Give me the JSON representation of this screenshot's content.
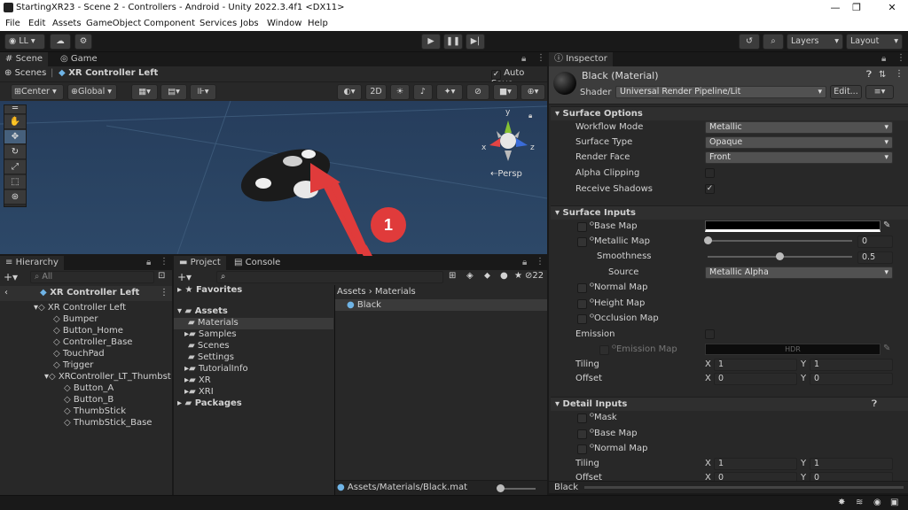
{
  "window": {
    "title": "StartingXR23 - Scene 2 - Controllers - Android - Unity 2022.3.4f1 <DX11>",
    "controls": [
      "—",
      "❐",
      "✕"
    ]
  },
  "menu": [
    "File",
    "Edit",
    "Assets",
    "GameObject",
    "Component",
    "Services",
    "Jobs",
    "Window",
    "Help"
  ],
  "toolbar": {
    "account": "LL",
    "layers": "Layers",
    "layout": "Layout"
  },
  "scene_tabs": {
    "scene": "Scene",
    "game": "Game"
  },
  "breadcrumb": {
    "scenes": "Scenes",
    "object": "XR Controller Left",
    "auto_save": "Auto Save"
  },
  "scene_toolbar": {
    "pivot": "Center",
    "space": "Global",
    "mode_2d": "2D"
  },
  "gizmo": {
    "x": "x",
    "y": "y",
    "z": "z",
    "persp": "Persp"
  },
  "annotation": {
    "number": "1"
  },
  "hierarchy": {
    "tab": "Hierarchy",
    "search_placeholder": "All",
    "root": "XR Controller Left",
    "items": [
      {
        "label": "XR Controller Left",
        "depth": 1
      },
      {
        "label": "Bumper",
        "depth": 2
      },
      {
        "label": "Button_Home",
        "depth": 2
      },
      {
        "label": "Controller_Base",
        "depth": 2
      },
      {
        "label": "TouchPad",
        "depth": 2
      },
      {
        "label": "Trigger",
        "depth": 2
      },
      {
        "label": "XRController_LT_Thumbst",
        "depth": 2
      },
      {
        "label": "Button_A",
        "depth": 3
      },
      {
        "label": "Button_B",
        "depth": 3
      },
      {
        "label": "ThumbStick",
        "depth": 3
      },
      {
        "label": "ThumbStick_Base",
        "depth": 3
      }
    ]
  },
  "project": {
    "tab_project": "Project",
    "tab_console": "Console",
    "hidden_count": "22",
    "favorites": "Favorites",
    "assets": "Assets",
    "folders": [
      "Materials",
      "Samples",
      "Scenes",
      "Settings",
      "TutorialInfo",
      "XR",
      "XRI"
    ],
    "packages": "Packages",
    "path_root": "Assets",
    "path_sep": "›",
    "path_leaf": "Materials",
    "files": [
      "Black"
    ],
    "status_path": "Assets/Materials/Black.mat"
  },
  "inspector": {
    "tab": "Inspector",
    "title": "Black (Material)",
    "shader_label": "Shader",
    "shader_value": "Universal Render Pipeline/Lit",
    "edit": "Edit...",
    "surface_options": {
      "header": "Surface Options",
      "workflow_label": "Workflow Mode",
      "workflow_value": "Metallic",
      "surface_label": "Surface Type",
      "surface_value": "Opaque",
      "render_face_label": "Render Face",
      "render_face_value": "Front",
      "alpha_label": "Alpha Clipping",
      "shadows_label": "Receive Shadows"
    },
    "surface_inputs": {
      "header": "Surface Inputs",
      "base_map": "Base Map",
      "metallic_map": "Metallic Map",
      "metallic_value": "0",
      "smoothness": "Smoothness",
      "smoothness_value": "0.5",
      "source": "Source",
      "source_value": "Metallic Alpha",
      "normal_map": "Normal Map",
      "height_map": "Height Map",
      "occlusion_map": "Occlusion Map",
      "emission": "Emission",
      "emission_map": "Emission Map",
      "hdr": "HDR",
      "tiling": "Tiling",
      "offset": "Offset",
      "x": "X",
      "y": "Y",
      "tiling_x": "1",
      "tiling_y": "1",
      "offset_x": "0",
      "offset_y": "0"
    },
    "detail_inputs": {
      "header": "Detail Inputs",
      "mask": "Mask",
      "base_map": "Base Map",
      "normal_map": "Normal Map",
      "tiling": "Tiling",
      "offset": "Offset",
      "tiling_x": "1",
      "tiling_y": "1",
      "offset_x": "0",
      "offset_y": "0"
    },
    "footer": "Black"
  },
  "colors": {
    "accent": "#e03b3b",
    "selection": "#2c5d87",
    "scene_bg": "#2a4463"
  }
}
